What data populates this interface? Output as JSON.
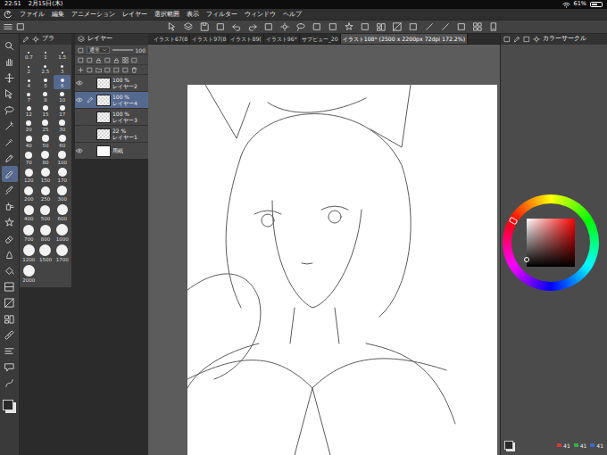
{
  "status_bar": {
    "time": "22:51",
    "date": "2月15日(木)",
    "battery": "61%",
    "battery_level": 0.61
  },
  "menu": [
    "ファイル",
    "編集",
    "アニメーション",
    "レイヤー",
    "選択範囲",
    "表示",
    "フィルター",
    "ウィンドウ",
    "ヘルプ"
  ],
  "tools": [
    {
      "selected": false
    },
    {
      "selected": false
    },
    {
      "selected": false
    },
    {
      "selected": false
    },
    {
      "selected": false
    },
    {
      "selected": false
    },
    {
      "selected": false
    },
    {
      "selected": false
    },
    {
      "selected": true
    },
    {
      "selected": false
    },
    {
      "selected": false
    },
    {
      "selected": false
    },
    {
      "selected": false
    },
    {
      "selected": false
    },
    {
      "selected": false
    },
    {
      "selected": false
    },
    {
      "selected": false
    },
    {
      "selected": false
    },
    {
      "selected": false
    },
    {
      "selected": false
    },
    {
      "selected": false
    },
    {
      "selected": false
    }
  ],
  "brush_panel": {
    "tab": "ブラ",
    "sizes": [
      {
        "label": "0.7",
        "selected": false
      },
      {
        "label": "1",
        "selected": false
      },
      {
        "label": "1.5",
        "selected": false
      },
      {
        "label": "2",
        "selected": false
      },
      {
        "label": "2.5",
        "selected": false
      },
      {
        "label": "3",
        "selected": false
      },
      {
        "label": "4",
        "selected": false
      },
      {
        "label": "5",
        "selected": false
      },
      {
        "label": "6",
        "selected": true
      },
      {
        "label": "7",
        "selected": false
      },
      {
        "label": "8",
        "selected": false
      },
      {
        "label": "10",
        "selected": false
      },
      {
        "label": "12",
        "selected": false
      },
      {
        "label": "15",
        "selected": false
      },
      {
        "label": "17",
        "selected": false
      },
      {
        "label": "20",
        "selected": false
      },
      {
        "label": "25",
        "selected": false
      },
      {
        "label": "30",
        "selected": false
      },
      {
        "label": "40",
        "selected": false
      },
      {
        "label": "50",
        "selected": false
      },
      {
        "label": "60",
        "selected": false
      },
      {
        "label": "70",
        "selected": false
      },
      {
        "label": "80",
        "selected": false
      },
      {
        "label": "100",
        "selected": false
      },
      {
        "label": "120",
        "selected": false
      },
      {
        "label": "150",
        "selected": false
      },
      {
        "label": "170",
        "selected": false
      },
      {
        "label": "200",
        "selected": false
      },
      {
        "label": "250",
        "selected": false
      },
      {
        "label": "300",
        "selected": false
      },
      {
        "label": "400",
        "selected": false
      },
      {
        "label": "500",
        "selected": false
      },
      {
        "label": "600",
        "selected": false
      },
      {
        "label": "700",
        "selected": false
      },
      {
        "label": "800",
        "selected": false
      },
      {
        "label": "1000",
        "selected": false
      },
      {
        "label": "1200",
        "selected": false
      },
      {
        "label": "1500",
        "selected": false
      },
      {
        "label": "1700",
        "selected": false
      },
      {
        "label": "2000",
        "selected": false
      }
    ]
  },
  "layer_panel": {
    "tab": "レイヤー",
    "blend_mode": "通常",
    "opacity": "100",
    "layers": [
      {
        "kind": "layer",
        "opacity": "100 %",
        "name": "レイヤー2",
        "visible": true,
        "selected": false
      },
      {
        "kind": "layer",
        "opacity": "100 %",
        "name": "レイヤー4",
        "visible": true,
        "selected": true
      },
      {
        "kind": "layer",
        "opacity": "100 %",
        "name": "レイヤー3",
        "visible": false,
        "selected": false
      },
      {
        "kind": "layer",
        "opacity": "22 %",
        "name": "レイヤー1",
        "visible": false,
        "selected": false
      },
      {
        "kind": "paper",
        "name": "用紙",
        "visible": true,
        "selected": false
      }
    ]
  },
  "document_tabs": [
    {
      "label": "イラスト67(8",
      "selected": false
    },
    {
      "label": "イラスト97(8",
      "selected": false
    },
    {
      "label": "イラスト89(",
      "selected": false
    },
    {
      "label": "イラスト96*",
      "selected": false
    },
    {
      "label": "サブビュー_20",
      "selected": false
    },
    {
      "label": "イラスト108* (2500 x 2200px 72dpi 172.2%)",
      "selected": true
    }
  ],
  "color_panel": {
    "title": "カラーサークル",
    "readout": [
      {
        "value": "41",
        "color": "#d83a3a"
      },
      {
        "value": "41",
        "color": "#3ab04a"
      },
      {
        "value": "41",
        "color": "#3a6ad8"
      }
    ]
  }
}
